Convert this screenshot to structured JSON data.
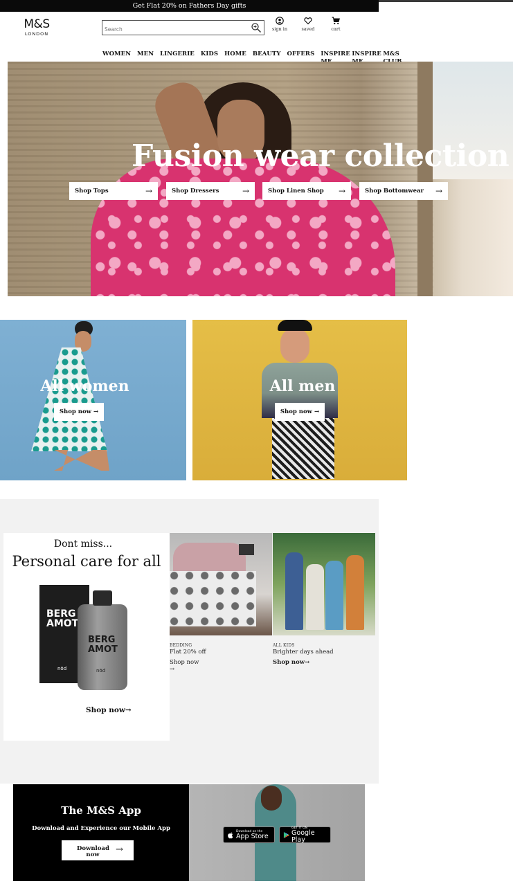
{
  "promo_banner": "Get Flat 20% on Fathers Day gifts",
  "logo": {
    "brand": "M&S",
    "city": "LONDON"
  },
  "search": {
    "placeholder": "Search"
  },
  "header_icons": {
    "sign_in": "sign in",
    "saved": "saved",
    "cart": "cart"
  },
  "nav": [
    "WOMEN",
    "MEN",
    "LINGERIE",
    "KIDS",
    "HOME",
    "BEAUTY",
    "OFFERS",
    "INSPIRE ME",
    "INSPIRE ME",
    "M&S CLUB"
  ],
  "hero": {
    "title": "Fusion wear collection",
    "buttons": [
      "Shop Tops",
      "Shop Dressers",
      "Shop Linen Shop",
      "Shop Bottomwear"
    ]
  },
  "categories": {
    "women": {
      "title": "All women",
      "button": "Shop now"
    },
    "men": {
      "title": "All men",
      "button": "Shop now"
    }
  },
  "promo": {
    "kicker": "Dont miss...",
    "title": "Personal care for all",
    "product_label": "BERG AMOT",
    "product_brand": "nōd",
    "shop": "Shop now",
    "tiles": [
      {
        "category": "BEDDING",
        "subtitle": "Flat 20% off",
        "shop": "Shop now"
      },
      {
        "category": "ALL KIDS",
        "subtitle": "Brighter days ahead",
        "shop": "Shop now"
      }
    ]
  },
  "app": {
    "title": "The M&S App",
    "subtitle": "Download and Experience our Mobile App",
    "button": "Download now",
    "app_store": {
      "small": "Download on the",
      "big": "App Store"
    },
    "google_play": {
      "small": "GET IT ON",
      "big": "Google Play"
    }
  },
  "icons": [
    "search-icon",
    "user-icon",
    "heart-icon",
    "cart-icon",
    "arrow-right-icon",
    "apple-icon",
    "play-icon"
  ]
}
